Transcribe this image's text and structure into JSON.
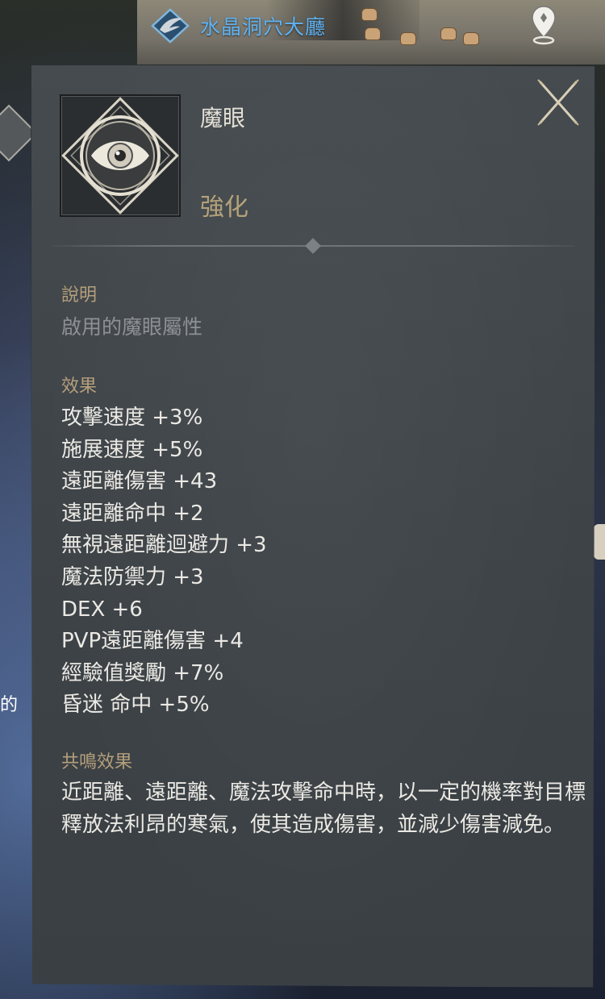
{
  "location": {
    "name": "水晶洞穴大廳",
    "icon": "wing-emblem-icon"
  },
  "map": {
    "pin_icon": "location-pin-icon"
  },
  "background": {
    "partial_text": "的"
  },
  "tooltip": {
    "item_name": "魔眼",
    "item_grade": "強化",
    "item_icon": "magic-eye-icon",
    "close_icon": "close-icon",
    "description_label": "說明",
    "description_text": "啟用的魔眼屬性",
    "effects_label": "效果",
    "effects": [
      "攻擊速度 +3%",
      "施展速度 +5%",
      "遠距離傷害 +43",
      "遠距離命中 +2",
      "無視遠距離迴避力 +3",
      "魔法防禦力 +3",
      "DEX +6",
      "PVP遠距離傷害 +4",
      "經驗值獎勵 +7%",
      "昏迷 命中 +5%"
    ],
    "resonance_label": "共鳴效果",
    "resonance_text": "近距離、遠距離、魔法攻擊命中時，以一定的機率對目標釋放法利昂的寒氣，使其造成傷害，並減少傷害減免。"
  },
  "colors": {
    "panel_bg": "#41474b",
    "label_gold": "#b59f7c",
    "location_blue": "#5fb2f2",
    "effect_text": "#ebe9e4",
    "desc_text": "#8e9193"
  }
}
